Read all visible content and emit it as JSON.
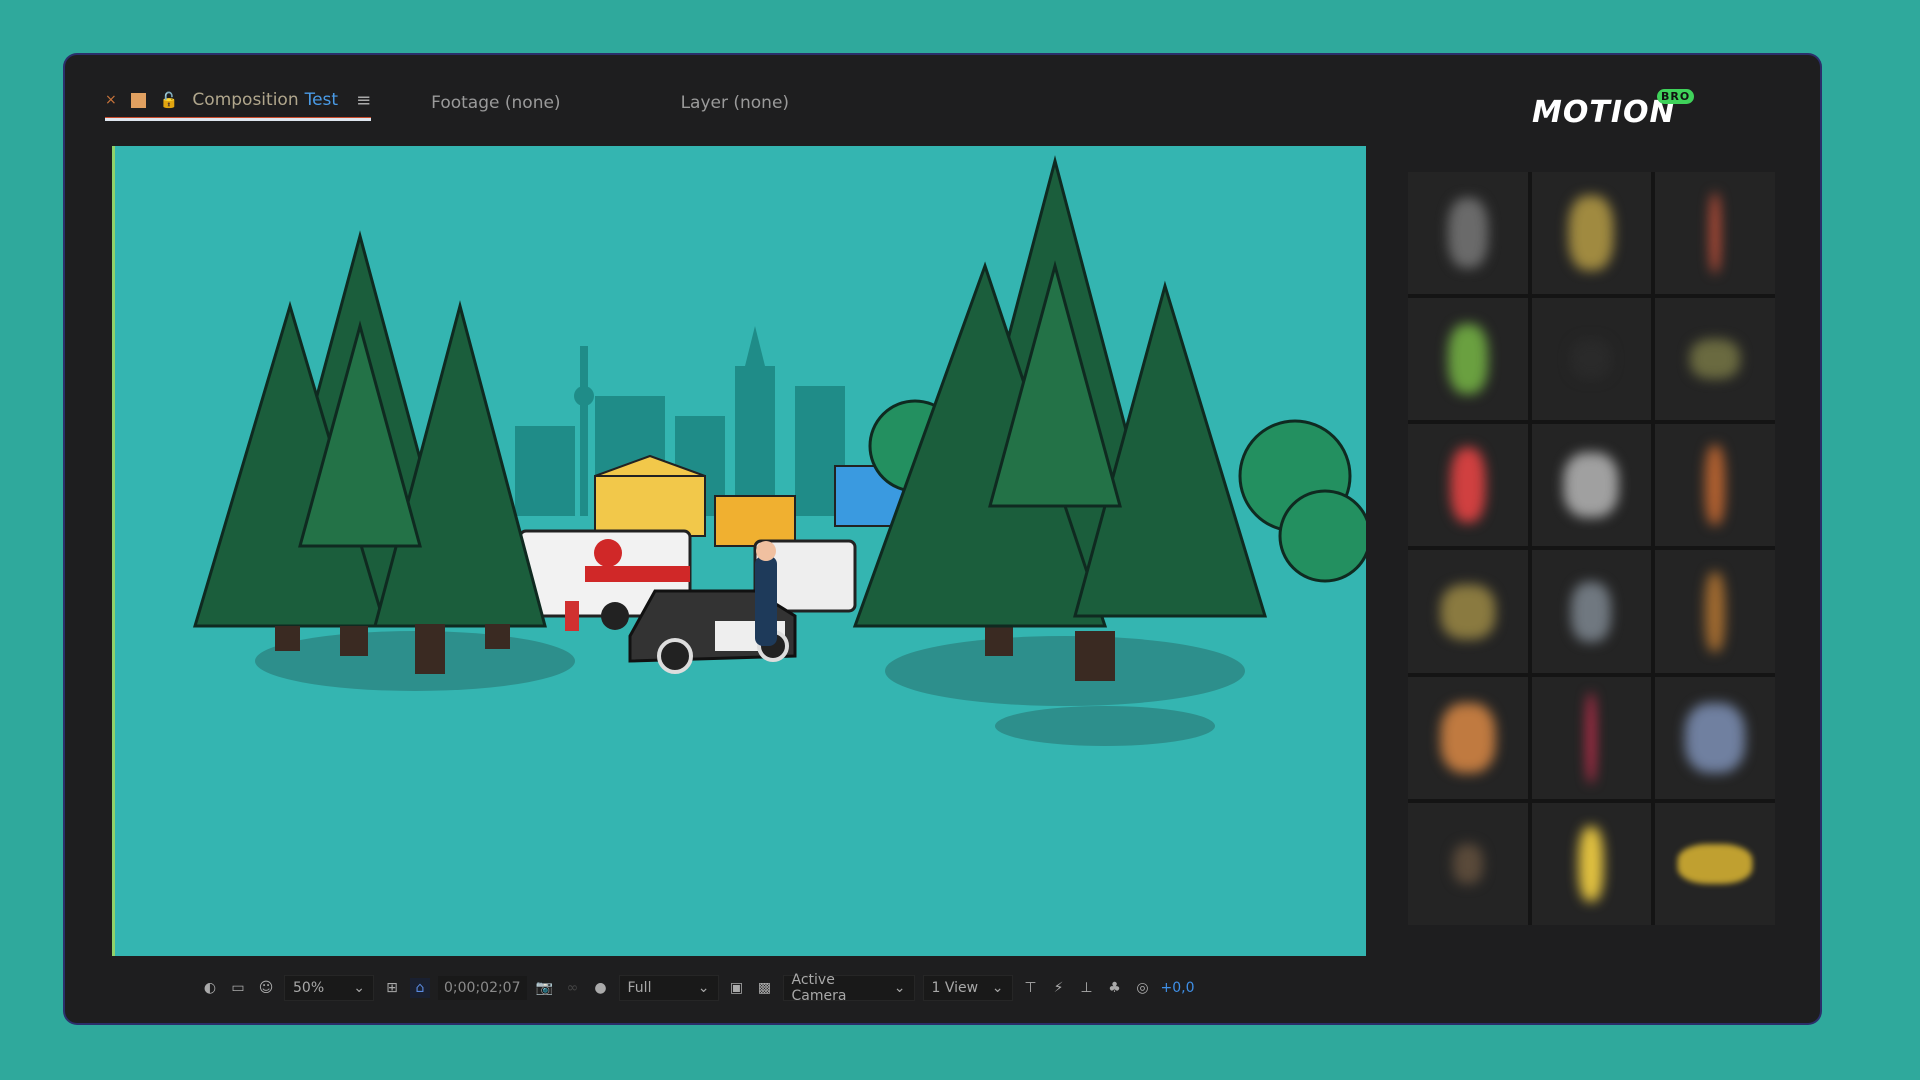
{
  "tabs": {
    "composition": {
      "label": "Composition",
      "name": "Test"
    },
    "footage": "Footage (none)",
    "layer": "Layer (none)"
  },
  "logo": {
    "text": "MOTION",
    "badge": "BRO"
  },
  "toolbar": {
    "zoom": "50%",
    "timecode": "0;00;02;07",
    "resolution": "Full",
    "camera": "Active Camera",
    "views": "1 View",
    "exposure": "+0,0"
  },
  "colors": {
    "background": "#2fa99c",
    "viewer": "#34b5b1",
    "accent": "#4a9be6",
    "brand": "#3fd25a"
  },
  "thumbnails": [
    [
      "#6a6a6a",
      "#a08a40",
      "#c0503a"
    ],
    [
      "#6aa040",
      "#2a2a2a",
      "#6a6a40"
    ],
    [
      "#d04040",
      "#a0a0a0",
      "#b06030"
    ],
    [
      "#8a7a40",
      "#707880",
      "#a06a30"
    ],
    [
      "#c07a40",
      "#d03050",
      "#7080a0"
    ],
    [
      "#5a4a3a",
      "#e0c040",
      "#c0a030"
    ]
  ]
}
